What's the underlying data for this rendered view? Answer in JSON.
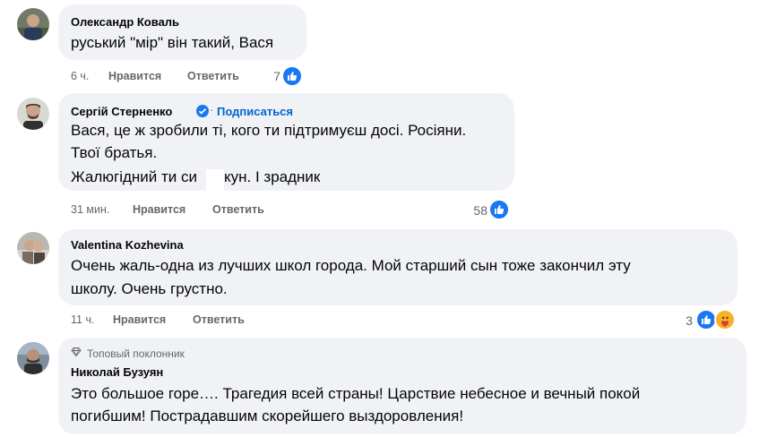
{
  "comments": [
    {
      "author": "Олександр Коваль",
      "lines": [
        "руський \"мір\" він такий, Вася"
      ],
      "time": "6 ч.",
      "like_label": "Нравится",
      "reply_label": "Ответить",
      "reactions": "7"
    },
    {
      "author": "Сергій Стерненко",
      "follow_label": "Подписаться",
      "lines": [
        "Вася, це ж зробили ті, кого ти підтримуєш досі. Росіяни.",
        "Твої братья.",
        "Жалюгідний ти си",
        "кун. І зрадник"
      ],
      "time": "31 мин.",
      "like_label": "Нравится",
      "reply_label": "Ответить",
      "reactions": "58"
    },
    {
      "author": "Valentina Kozhevina",
      "lines": [
        "Очень жаль-одна из лучших школ города. Мой старший сын тоже закончил эту",
        "школу. Очень грустно."
      ],
      "time": "11 ч.",
      "like_label": "Нравится",
      "reply_label": "Ответить",
      "reactions": "3"
    },
    {
      "badge": "Топовый поклонник",
      "author": "Николай Бузуян",
      "lines": [
        "Это большое горе…. Трагедия всей страны! Царствие небесное и вечный покой",
        "погибшим! Пострадавшим скорейшего выздоровления!"
      ]
    }
  ],
  "colors": {
    "bubble": "#f0f2f5",
    "meta": "#65676b",
    "link": "#0064d1",
    "like": "#1877f2"
  }
}
